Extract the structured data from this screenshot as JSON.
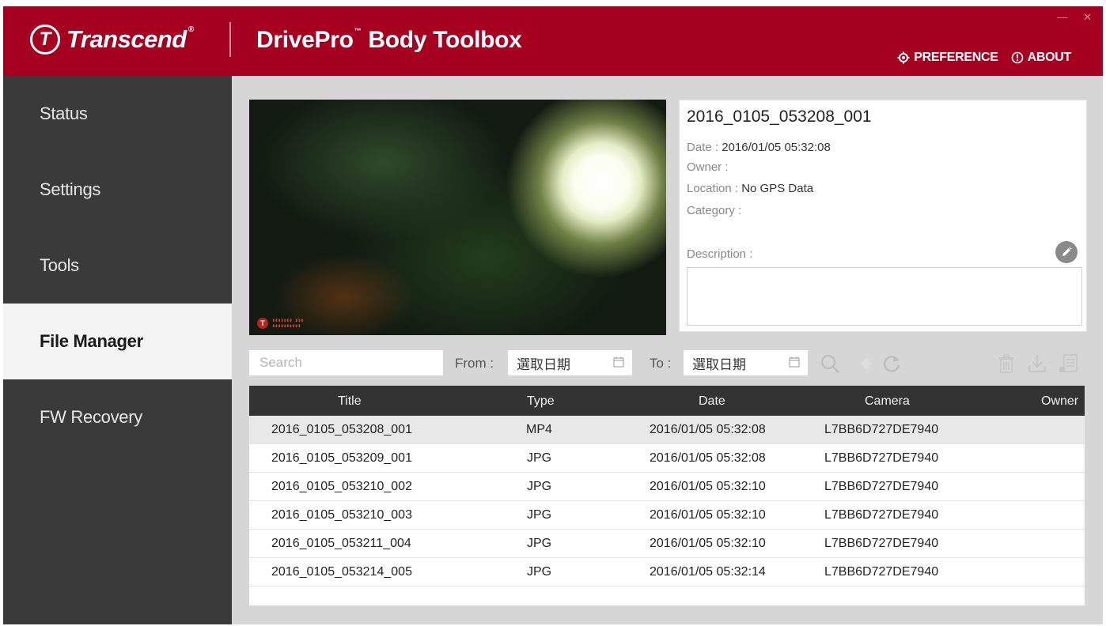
{
  "header": {
    "brand": "Transcend",
    "app_title_prefix": "DrivePro",
    "app_title_tm": "™",
    "app_title_suffix": "Body Toolbox",
    "preference_label": "PREFERENCE",
    "about_label": "ABOUT",
    "colors": {
      "accent": "#a50020"
    }
  },
  "sidebar": {
    "items": [
      {
        "label": "Status"
      },
      {
        "label": "Settings"
      },
      {
        "label": "Tools"
      },
      {
        "label": "File Manager",
        "active": true
      },
      {
        "label": "FW Recovery"
      }
    ]
  },
  "details": {
    "title": "2016_0105_053208_001",
    "date_label": "Date :",
    "date_value": "2016/01/05 05:32:08",
    "owner_label": "Owner :",
    "owner_value": "",
    "location_label": "Location :",
    "location_value": "No GPS Data",
    "category_label": "Category :",
    "category_value": "",
    "description_label": "Description :",
    "description_value": ""
  },
  "toolbar": {
    "search_placeholder": "Search",
    "from_label": "From :",
    "from_value": "選取日期",
    "to_label": "To :",
    "to_value": "選取日期"
  },
  "table": {
    "columns": [
      "Title",
      "Type",
      "Date",
      "Camera",
      "Owner"
    ],
    "rows": [
      {
        "title": "2016_0105_053208_001",
        "type": "MP4",
        "date": "2016/01/05 05:32:08",
        "camera": "L7BB6D727DE7940",
        "owner": ""
      },
      {
        "title": "2016_0105_053209_001",
        "type": "JPG",
        "date": "2016/01/05 05:32:08",
        "camera": "L7BB6D727DE7940",
        "owner": ""
      },
      {
        "title": "2016_0105_053210_002",
        "type": "JPG",
        "date": "2016/01/05 05:32:10",
        "camera": "L7BB6D727DE7940",
        "owner": ""
      },
      {
        "title": "2016_0105_053210_003",
        "type": "JPG",
        "date": "2016/01/05 05:32:10",
        "camera": "L7BB6D727DE7940",
        "owner": ""
      },
      {
        "title": "2016_0105_053211_004",
        "type": "JPG",
        "date": "2016/01/05 05:32:10",
        "camera": "L7BB6D727DE7940",
        "owner": ""
      },
      {
        "title": "2016_0105_053214_005",
        "type": "JPG",
        "date": "2016/01/05 05:32:14",
        "camera": "L7BB6D727DE7940",
        "owner": ""
      }
    ]
  }
}
